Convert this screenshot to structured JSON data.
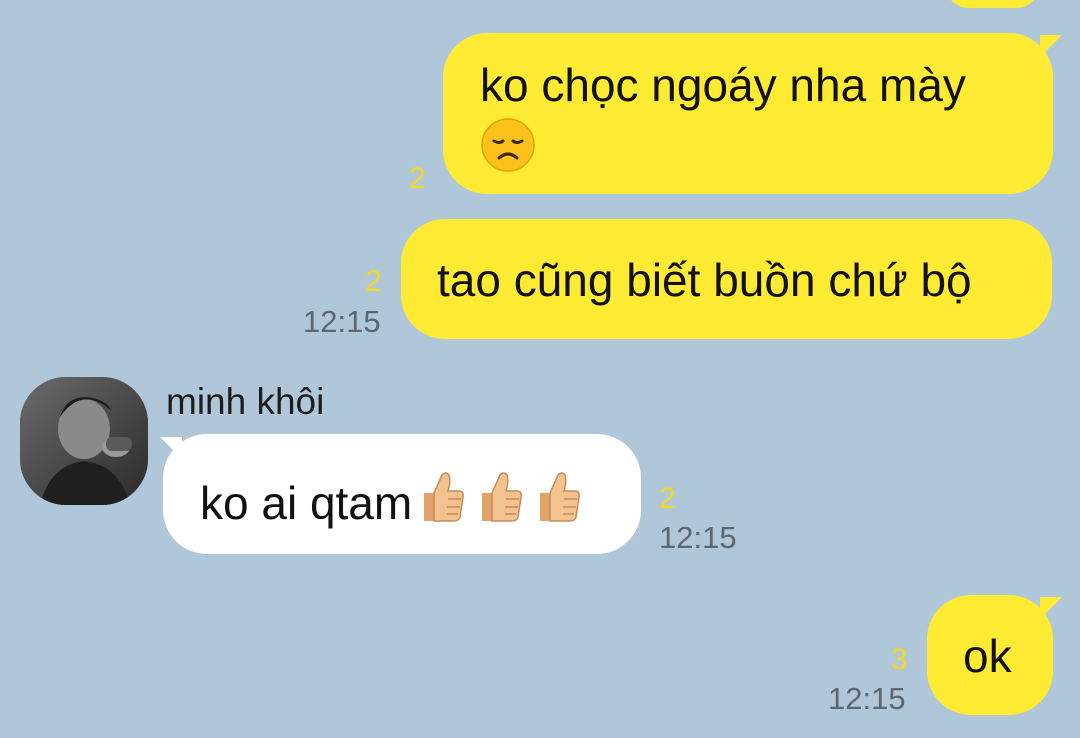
{
  "chat": {
    "background_color": "#b0c6d9",
    "outgoing_bubble_color": "#ffeb33",
    "incoming_bubble_color": "#ffffff",
    "read_count_color": "#f2d71e"
  },
  "messages": [
    {
      "direction": "outgoing",
      "text": "ko chọc ngoáy nha mày",
      "emoji": "disappointed-face",
      "read_count": "2",
      "time": ""
    },
    {
      "direction": "outgoing",
      "text": "tao cũng biết buồn chứ bộ",
      "read_count": "2",
      "time": "12:15"
    },
    {
      "direction": "incoming",
      "sender": "minh khôi",
      "avatar": "profile-photo",
      "text": "ko ai qtam",
      "emoji": "thumbs-up x3",
      "read_count": "2",
      "time": "12:15"
    },
    {
      "direction": "outgoing",
      "text": "ok",
      "read_count": "3",
      "time": "12:15"
    }
  ]
}
